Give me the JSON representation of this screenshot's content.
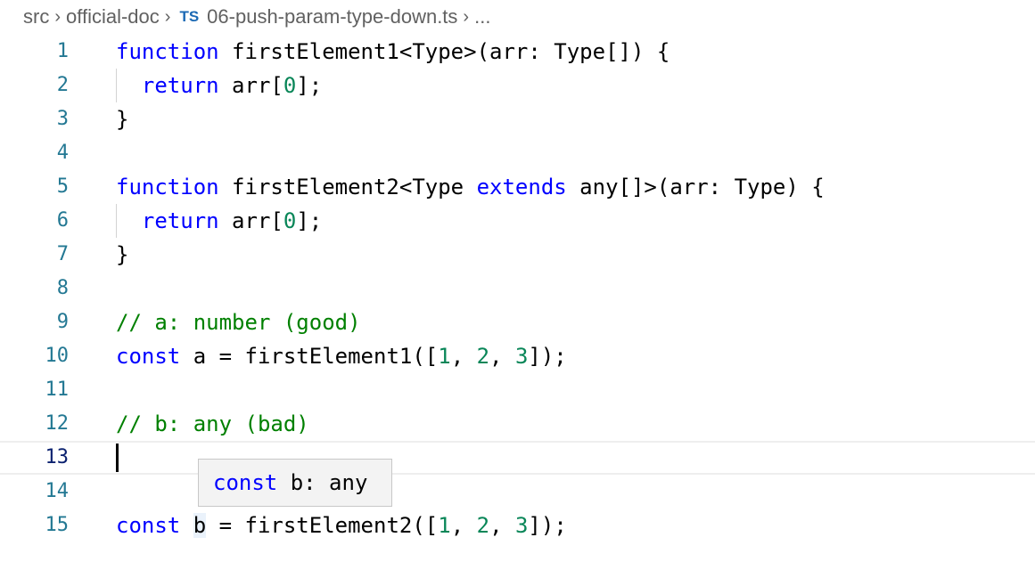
{
  "breadcrumb": {
    "items": [
      "src",
      "official-doc"
    ],
    "file_icon": "TS",
    "file_name": "06-push-param-type-down.ts",
    "trailing": "..."
  },
  "editor": {
    "current_line": 13,
    "lines": [
      {
        "n": "1",
        "tokens": [
          [
            "kw",
            "function"
          ],
          [
            "t",
            " firstElement1<Type>(arr: Type[]) {"
          ]
        ]
      },
      {
        "n": "2",
        "guide": true,
        "tokens": [
          [
            "t",
            "  "
          ],
          [
            "kw",
            "return"
          ],
          [
            "t",
            " arr["
          ],
          [
            "num",
            "0"
          ],
          [
            "t",
            "];"
          ]
        ]
      },
      {
        "n": "3",
        "tokens": [
          [
            "t",
            "}"
          ]
        ]
      },
      {
        "n": "4",
        "tokens": []
      },
      {
        "n": "5",
        "tokens": [
          [
            "kw",
            "function"
          ],
          [
            "t",
            " firstElement2<Type "
          ],
          [
            "kw",
            "extends"
          ],
          [
            "t",
            " any[]>(arr: Type) {"
          ]
        ]
      },
      {
        "n": "6",
        "guide": true,
        "tokens": [
          [
            "t",
            "  "
          ],
          [
            "kw",
            "return"
          ],
          [
            "t",
            " arr["
          ],
          [
            "num",
            "0"
          ],
          [
            "t",
            "];"
          ]
        ]
      },
      {
        "n": "7",
        "tokens": [
          [
            "t",
            "}"
          ]
        ]
      },
      {
        "n": "8",
        "tokens": []
      },
      {
        "n": "9",
        "tokens": [
          [
            "cmt",
            "// a: number (good)"
          ]
        ]
      },
      {
        "n": "10",
        "tokens": [
          [
            "kw",
            "const"
          ],
          [
            "t",
            " a = firstElement1(["
          ],
          [
            "num",
            "1"
          ],
          [
            "t",
            ", "
          ],
          [
            "num",
            "2"
          ],
          [
            "t",
            ", "
          ],
          [
            "num",
            "3"
          ],
          [
            "t",
            "]);"
          ]
        ]
      },
      {
        "n": "11",
        "tokens": []
      },
      {
        "n": "12",
        "tokens": [
          [
            "cmt",
            "// b: any (bad)"
          ]
        ]
      },
      {
        "n": "13",
        "current": true,
        "tokens": []
      },
      {
        "n": "14",
        "tokens": []
      },
      {
        "n": "15",
        "tokens": [
          [
            "kw",
            "const"
          ],
          [
            "t",
            " "
          ],
          [
            "hover",
            "b"
          ],
          [
            "t",
            " = firstElement2(["
          ],
          [
            "num",
            "1"
          ],
          [
            "t",
            ", "
          ],
          [
            "num",
            "2"
          ],
          [
            "t",
            ", "
          ],
          [
            "num",
            "3"
          ],
          [
            "t",
            "]);"
          ]
        ]
      }
    ]
  },
  "hover": {
    "keyword": "const",
    "text": " b: any"
  },
  "colors": {
    "keyword": "#0000ff",
    "number": "#098658",
    "comment": "#008000",
    "line_number": "#237893",
    "line_number_active": "#0b216f"
  }
}
